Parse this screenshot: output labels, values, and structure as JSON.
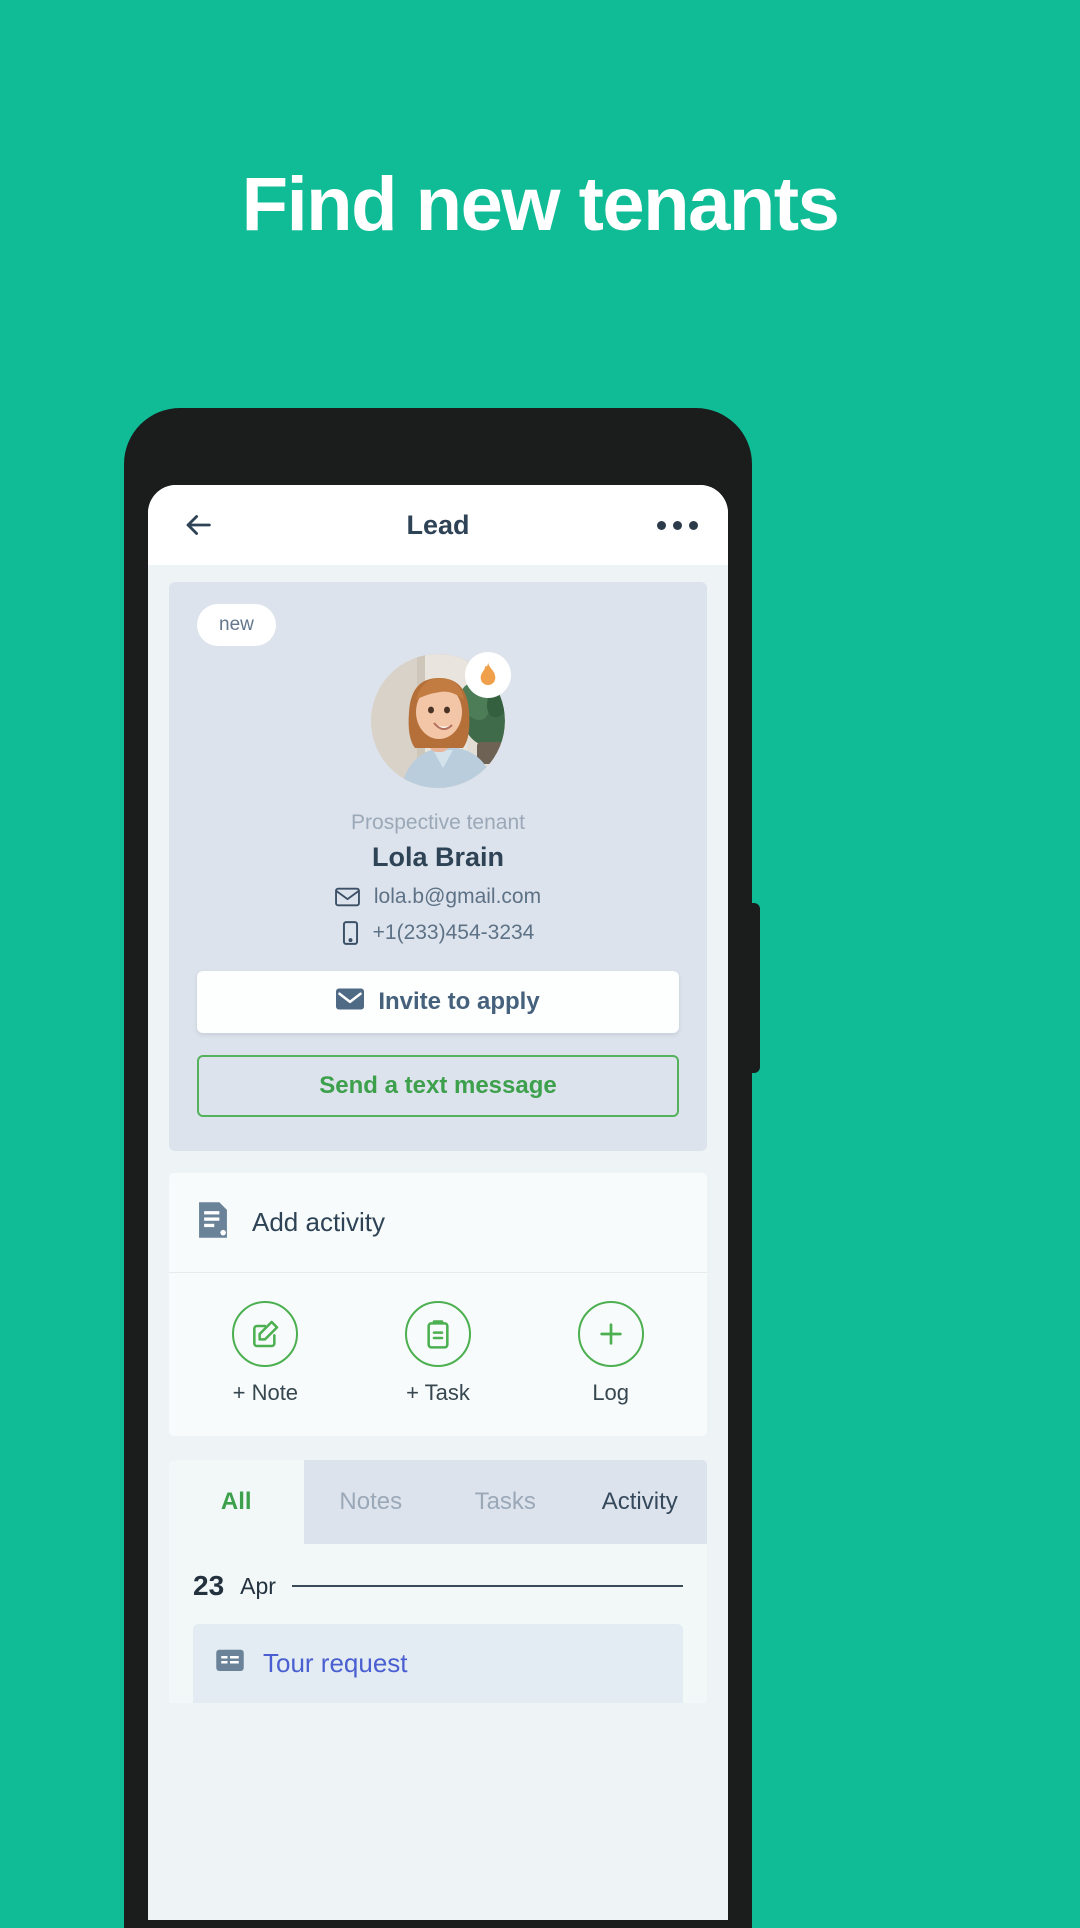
{
  "hero": {
    "title": "Find new tenants"
  },
  "colors": {
    "brand_green": "#0fbc96",
    "accent_green": "#4caf50",
    "slate": "#2f4356",
    "card_blue": "#dde3ec",
    "link_blue": "#4a5fd0",
    "flame_orange": "#f0a04b"
  },
  "header": {
    "back_icon": "arrow-left-icon",
    "title": "Lead",
    "menu_icon": "more-horizontal-icon"
  },
  "profile": {
    "badge": "new",
    "avatar_icon": "user-photo",
    "flame_icon": "flame-icon",
    "role": "Prospective tenant",
    "name": "Lola Brain",
    "email": "lola.b@gmail.com",
    "email_icon": "envelope-icon",
    "phone": "+1(233)454-3234",
    "phone_icon": "mobile-icon",
    "invite_button": "Invite to apply",
    "invite_icon": "envelope-filled-icon",
    "text_button": "Send a text message"
  },
  "activity": {
    "header_label": "Add activity",
    "header_icon": "document-icon",
    "actions": [
      {
        "label": "+ Note",
        "icon": "note-edit-icon"
      },
      {
        "label": "+ Task",
        "icon": "clipboard-icon"
      },
      {
        "label": "Log",
        "icon": "plus-circle-icon"
      }
    ]
  },
  "tabs": {
    "items": [
      {
        "label": "All",
        "state": "active"
      },
      {
        "label": "Notes",
        "state": "muted"
      },
      {
        "label": "Tasks",
        "state": "muted"
      },
      {
        "label": "Activity",
        "state": "dark"
      }
    ]
  },
  "timeline": {
    "date_day": "23",
    "date_month": "Apr",
    "entries": [
      {
        "title": "Tour request",
        "icon": "message-icon"
      }
    ]
  }
}
